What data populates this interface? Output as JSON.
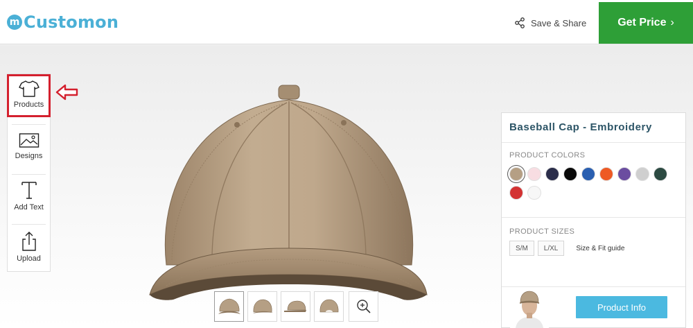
{
  "brand": {
    "logo_mark": "m",
    "name": "Customon"
  },
  "header": {
    "save_share_label": "Save & Share",
    "save_share_icon": "share-icon",
    "get_price_label": "Get Price",
    "get_price_color": "#2e9f37"
  },
  "toolbar": {
    "items": [
      {
        "label": "Products",
        "icon": "tshirt-icon",
        "selected": true
      },
      {
        "label": "Designs",
        "icon": "image-icon"
      },
      {
        "label": "Add Text",
        "icon": "text-icon"
      },
      {
        "label": "Upload",
        "icon": "upload-icon"
      }
    ]
  },
  "product": {
    "title": "Baseball Cap - Embroidery",
    "cap_color": "#b59f84",
    "colors_label": "PRODUCT COLORS",
    "colors": [
      "#b59f84",
      "#f8dde2",
      "#2a2d4a",
      "#0a0a0a",
      "#2a5fb0",
      "#ee5a24",
      "#6b4da0",
      "#cfcfcf",
      "#2c4a42",
      "#d33232",
      "#f7f7f7"
    ],
    "selected_color_index": 0,
    "sizes_label": "PRODUCT SIZES",
    "sizes": [
      "S/M",
      "L/XL"
    ],
    "size_guide_label": "Size & Fit guide",
    "info_button_label": "Product Info"
  },
  "views": {
    "thumbnails": [
      "front",
      "front-right",
      "side",
      "back"
    ],
    "selected_index": 0,
    "zoom_icon": "zoom-in-icon"
  }
}
